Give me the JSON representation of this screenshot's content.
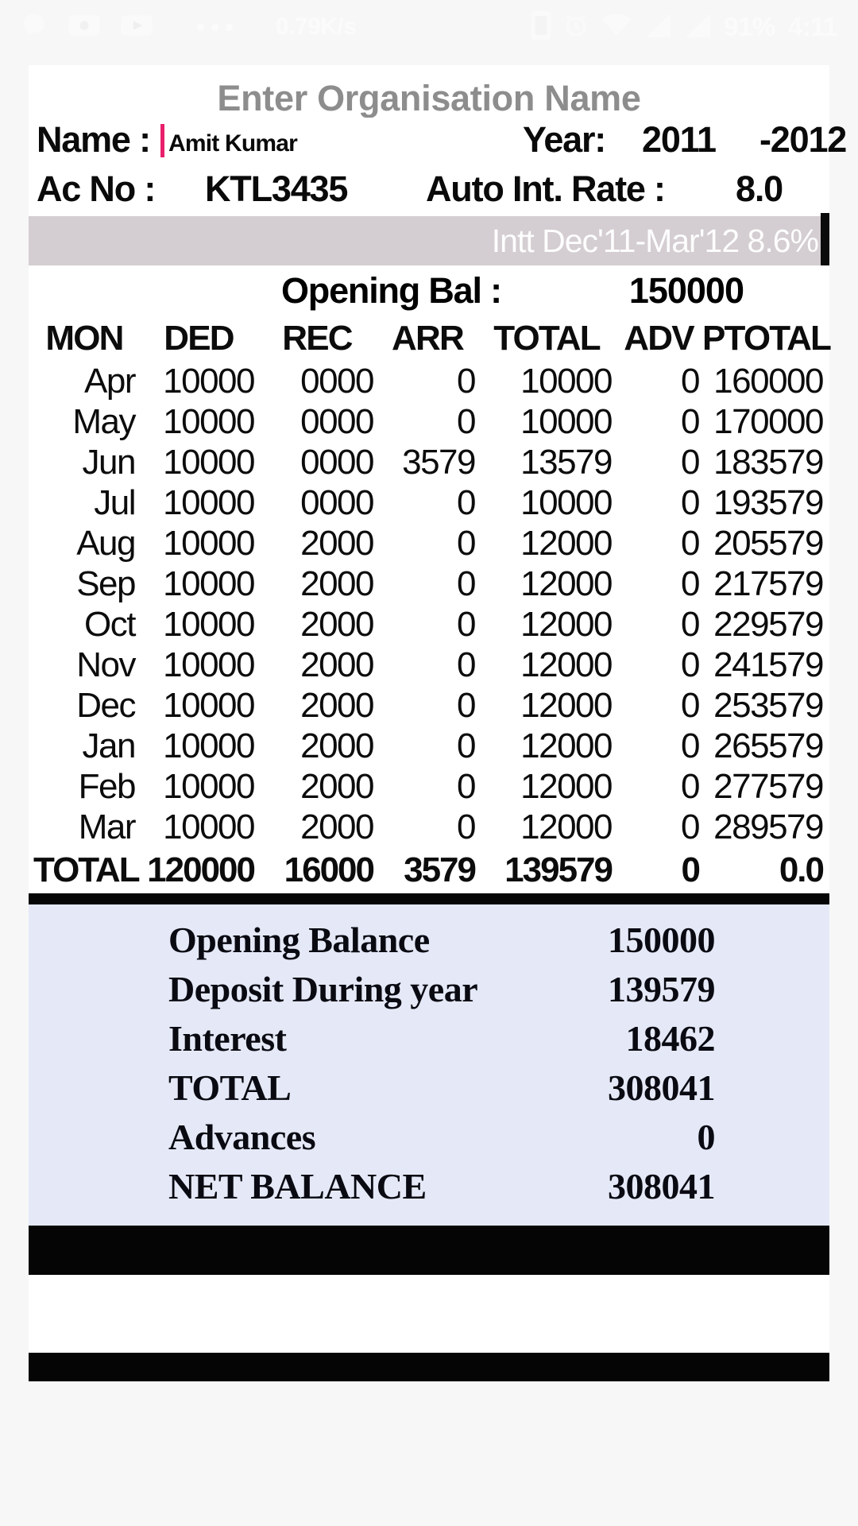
{
  "statusbar": {
    "icons_left": [
      "message-icon",
      "video-icon",
      "youtube-icon",
      "more-dots-icon"
    ],
    "data_speed": "0.79K/s",
    "icons_right": [
      "sim-icon",
      "alarm-icon",
      "wifi-icon",
      "signal-1-icon",
      "signal-2-icon"
    ],
    "battery": "91%",
    "time": "4:11"
  },
  "header": {
    "org_placeholder": "Enter Organisation Name",
    "name_label": "Name  :",
    "name_value": "Amit Kumar",
    "year_label": "Year:",
    "year_from": "2011",
    "year_to": "-2012",
    "acno_label": "Ac No :",
    "acno_value": "KTL3435",
    "rate_label": "Auto Int. Rate :",
    "rate_value": "8.0",
    "intt_banner": "Intt Dec'11-Mar'12 8.6%",
    "opening_bal_label": "Opening Bal :",
    "opening_bal_value": "150000"
  },
  "colors": {
    "banner_bg": "#d4cdd1",
    "summary_bg": "#e5e9f7",
    "caret": "#e8206c",
    "placeholder": "#8d8d8d",
    "dim_value": "#dedede"
  },
  "table": {
    "columns": [
      "MON",
      "DED",
      "REC",
      "ARR",
      "TOTAL",
      "ADV",
      "PTOTAL"
    ],
    "rows": [
      {
        "mon": "Apr",
        "ded": "10000",
        "rec": "0000",
        "rec_dim": true,
        "arr": "0",
        "total": "10000",
        "adv": "0",
        "ptotal": "160000"
      },
      {
        "mon": "May",
        "ded": "10000",
        "rec": "0000",
        "rec_dim": true,
        "arr": "0",
        "total": "10000",
        "adv": "0",
        "ptotal": "170000"
      },
      {
        "mon": "Jun",
        "ded": "10000",
        "rec": "0000",
        "rec_dim": true,
        "arr": "3579",
        "total": "13579",
        "adv": "0",
        "ptotal": "183579"
      },
      {
        "mon": "Jul",
        "ded": "10000",
        "rec": "0000",
        "rec_dim": true,
        "arr": "0",
        "total": "10000",
        "adv": "0",
        "ptotal": "193579"
      },
      {
        "mon": "Aug",
        "ded": "10000",
        "rec": "2000",
        "rec_dim": false,
        "arr": "0",
        "total": "12000",
        "adv": "0",
        "ptotal": "205579"
      },
      {
        "mon": "Sep",
        "ded": "10000",
        "rec": "2000",
        "rec_dim": false,
        "arr": "0",
        "total": "12000",
        "adv": "0",
        "ptotal": "217579"
      },
      {
        "mon": "Oct",
        "ded": "10000",
        "rec": "2000",
        "rec_dim": false,
        "arr": "0",
        "total": "12000",
        "adv": "0",
        "ptotal": "229579"
      },
      {
        "mon": "Nov",
        "ded": "10000",
        "rec": "2000",
        "rec_dim": false,
        "arr": "0",
        "total": "12000",
        "adv": "0",
        "ptotal": "241579"
      },
      {
        "mon": "Dec",
        "ded": "10000",
        "rec": "2000",
        "rec_dim": false,
        "arr": "0",
        "total": "12000",
        "adv": "0",
        "ptotal": "253579"
      },
      {
        "mon": "Jan",
        "ded": "10000",
        "rec": "2000",
        "rec_dim": false,
        "arr": "0",
        "total": "12000",
        "adv": "0",
        "ptotal": "265579"
      },
      {
        "mon": "Feb",
        "ded": "10000",
        "rec": "2000",
        "rec_dim": false,
        "arr": "0",
        "total": "12000",
        "adv": "0",
        "ptotal": "277579"
      },
      {
        "mon": "Mar",
        "ded": "10000",
        "rec": "2000",
        "rec_dim": false,
        "arr": "0",
        "total": "12000",
        "adv": "0",
        "ptotal": "289579"
      }
    ],
    "total_row": {
      "mon": "TOTAL",
      "ded": "120000",
      "rec": "16000",
      "arr": "3579",
      "total": "139579",
      "adv": "0",
      "ptotal": "0.0"
    }
  },
  "summary": {
    "rows": [
      {
        "label": "Opening Balance",
        "value": "150000"
      },
      {
        "label": "Deposit During year",
        "value": "139579"
      },
      {
        "label": "Interest",
        "value": "18462"
      },
      {
        "label": "TOTAL",
        "value": "308041"
      },
      {
        "label": "Advances",
        "value": "0"
      },
      {
        "label": "NET BALANCE",
        "value": "308041"
      }
    ]
  }
}
